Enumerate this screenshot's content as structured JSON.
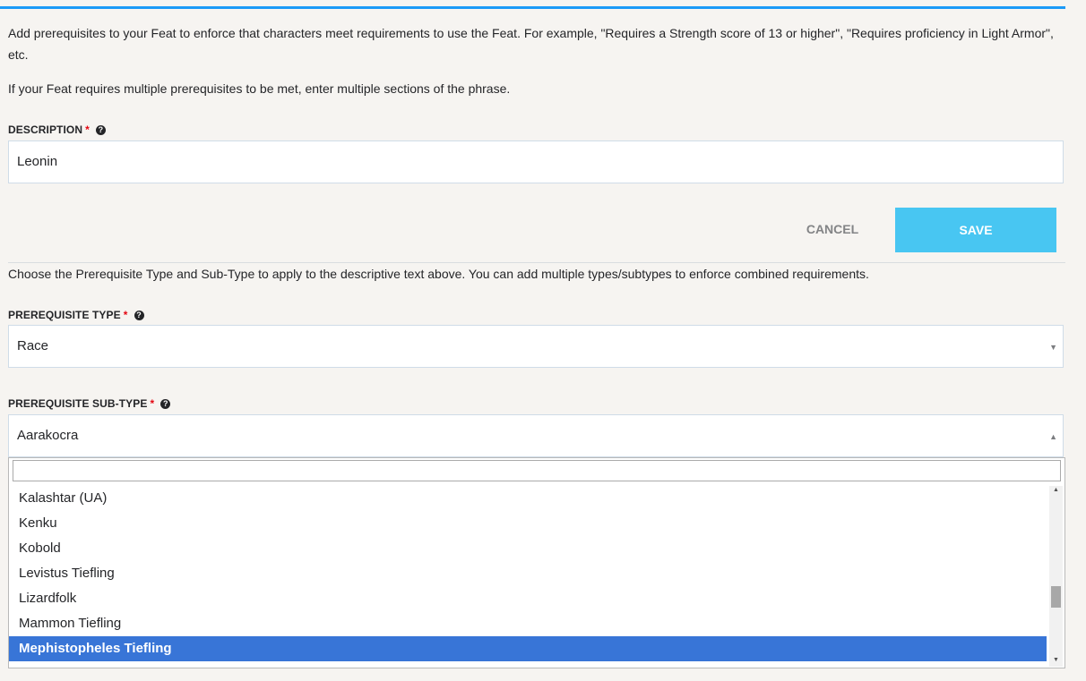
{
  "intro": {
    "text1": "Add prerequisites to your Feat to enforce that characters meet requirements to use the Feat. For example, \"Requires a Strength score of 13 or higher\", \"Requires proficiency in Light Armor\", etc.",
    "text2": "If your Feat requires multiple prerequisites to be met, enter multiple sections of the phrase."
  },
  "description": {
    "label": "DESCRIPTION",
    "required_mark": "*",
    "help_icon": "question-circle-icon",
    "value": "Leonin"
  },
  "actions": {
    "cancel_label": "CANCEL",
    "save_label": "SAVE",
    "save_color": "#48c6f2"
  },
  "type_intro": "Choose the Prerequisite Type and Sub-Type to apply to the descriptive text above. You can add multiple types/subtypes to enforce combined requirements.",
  "prereq_type": {
    "label": "PREREQUISITE TYPE",
    "required_mark": "*",
    "value": "Race",
    "caret": "▼"
  },
  "prereq_subtype": {
    "label": "PREREQUISITE SUB-TYPE",
    "required_mark": "*",
    "value": "Aarakocra",
    "caret": "▲",
    "search_value": "",
    "options": [
      "Kalashtar (UA)",
      "Kenku",
      "Kobold",
      "Levistus Tiefling",
      "Lizardfolk",
      "Mammon Tiefling",
      "Mephistopheles Tiefling"
    ],
    "highlighted": "Mephistopheles Tiefling",
    "highlight_color": "#3875d7"
  },
  "scroll": {
    "up": "▲",
    "down": "▼"
  }
}
